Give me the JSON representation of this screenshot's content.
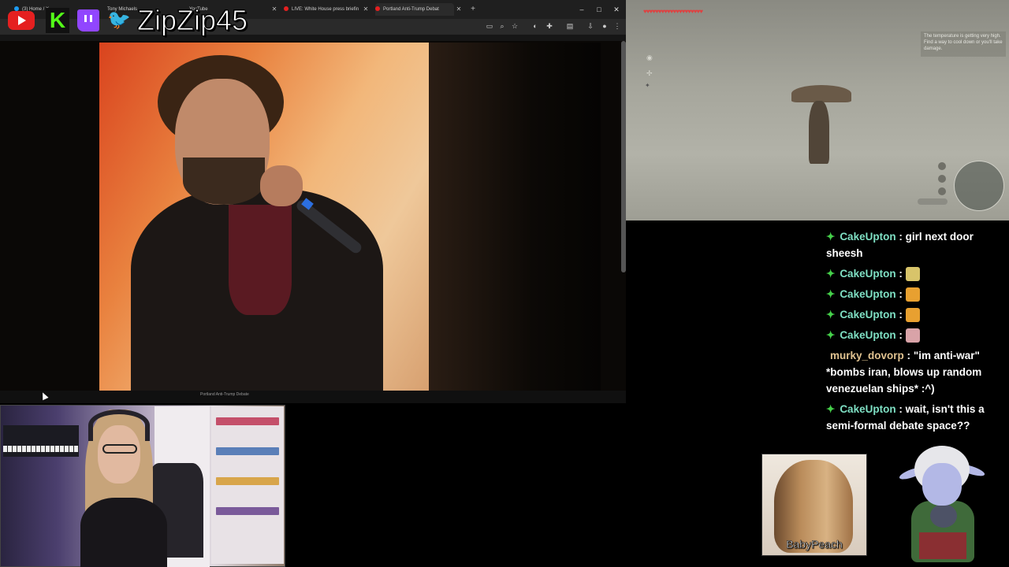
{
  "browser": {
    "tabs": [
      {
        "label": "(3) Home / X",
        "color": "#1d9bf0"
      },
      {
        "label": "Tony Michaels",
        "color": "#e52020"
      },
      {
        "label": "YouTube",
        "color": "#e52020"
      },
      {
        "label": "LIVE: White House press briefin",
        "color": "#e52020"
      },
      {
        "label": "Portland Anti-Trump Debat",
        "color": "#e52020"
      }
    ],
    "new_tab": "+",
    "window_controls": {
      "minimize": "–",
      "maximize": "□",
      "close": "✕"
    },
    "timeline_text": "Portland Anti-Trump Debate"
  },
  "social": {
    "youtube": "youtube-icon",
    "kick": "K",
    "twitch": "twitch-icon",
    "twitter": "twitter-icon",
    "handle": "ZipZip45"
  },
  "game": {
    "hearts": "♥♥♥♥♥♥♥♥♥♥♥♥♥♥♥♥♥♥♥♥",
    "warning": "The temperature is getting very high. Find a way to cool down or you'll take damage."
  },
  "chat": {
    "messages": [
      {
        "user": "CakeUpton",
        "text": "girl next door sheesh",
        "gem": true
      },
      {
        "user": "CakeUpton",
        "text": "",
        "emote": "you-tried-emote",
        "emote_color": "#d8c46a",
        "gem": true
      },
      {
        "user": "CakeUpton",
        "text": "",
        "emote": "fire-emote",
        "emote_color": "#e8a030",
        "gem": true
      },
      {
        "user": "CakeUpton",
        "text": "",
        "emote": "fire-emote",
        "emote_color": "#e8a030",
        "gem": true
      },
      {
        "user": "CakeUpton",
        "text": "",
        "emote": "cat-emote",
        "emote_color": "#d9a3a8",
        "gem": true
      },
      {
        "user": "murky_dovorp",
        "text": "\"im anti-war\" *bombs iran, blows up random venezuelan ships* :^)",
        "gem": false
      },
      {
        "user": "CakeUpton",
        "text": "wait, isn't this a semi-formal debate space??",
        "gem": true
      }
    ],
    "separator": ":"
  },
  "avatars": {
    "peach_label": "BabyPeach"
  },
  "colors": {
    "chat_user": "#7fe0c4",
    "chat_user_alt": "#e0c290",
    "gem": "#45d04a"
  }
}
